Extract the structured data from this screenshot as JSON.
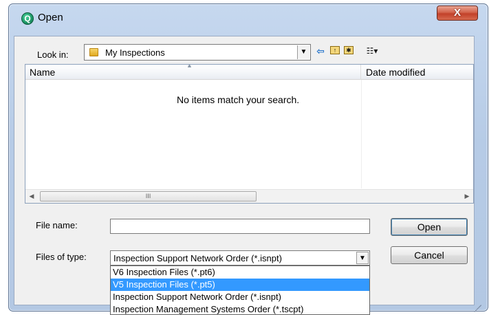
{
  "window": {
    "title": "Open",
    "app_icon_glyph": "Q",
    "close_glyph": "X"
  },
  "look_in": {
    "label": "Look in:",
    "value": "My Inspections",
    "dropdown_glyph": "▼"
  },
  "toolbar": {
    "back_glyph": "⇦",
    "up_glyph": "↑",
    "new_folder_glyph": "✱",
    "view_glyph": "☷▾",
    "icons": [
      "back-arrow-icon",
      "up-folder-icon",
      "new-folder-icon",
      "view-menu-icon"
    ]
  },
  "file_list": {
    "columns": [
      "Name",
      "Date modified"
    ],
    "sort_glyph": "▲",
    "empty_message": "No items match your search.",
    "scroll_left_glyph": "◀",
    "scroll_right_glyph": "▶",
    "thumb_glyph": "III"
  },
  "file_name": {
    "label": "File name:",
    "value": "",
    "placeholder": ""
  },
  "file_type": {
    "label": "Files of type:",
    "value": "Inspection Support Network Order (*.isnpt)",
    "dropdown_glyph": "▼",
    "options": [
      "V6 Inspection Files (*.pt6)",
      "V5 Inspection Files (*.pt5)",
      "Inspection Support Network Order (*.isnpt)",
      "Inspection Management Systems Order (*.tscpt)"
    ],
    "highlighted_index": 1
  },
  "buttons": {
    "open": "Open",
    "cancel": "Cancel"
  },
  "colors": {
    "selection": "#3399ff",
    "window_frame": "#b6cbe6",
    "close_button": "#c2412a"
  }
}
